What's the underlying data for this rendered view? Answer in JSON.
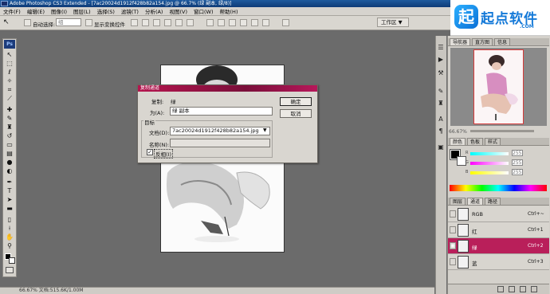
{
  "window": {
    "title": "Adobe Photoshop CS3 Extended - [7ac20024d1912f428b82a154.jpg @ 66.7% (绿 副本, 绿/8)]"
  },
  "brand": {
    "mark": "起",
    "name": "起点软件",
    "sub": ".COM"
  },
  "menu": [
    "文件(F)",
    "编辑(E)",
    "图像(I)",
    "图层(L)",
    "选择(S)",
    "滤镜(T)",
    "分析(A)",
    "视图(V)",
    "窗口(W)",
    "帮助(H)"
  ],
  "options": {
    "auto_select_label": "自动选择:",
    "auto_select_value": "组",
    "transform_label": "显示变换控件",
    "workspace_label": "工作区 ▼"
  },
  "dialog": {
    "title": "复制通道",
    "copy_label": "复制:",
    "copy_value": "绿",
    "as_label": "为(A):",
    "as_value": "绿 副本",
    "ok_label": "确定",
    "cancel_label": "取消",
    "target_group_label": "目标",
    "document_label": "文档(D):",
    "document_value": "7ac20024d1912f428b82a154.jpg",
    "name_label": "名称(N):",
    "name_value": "",
    "invert_label": "反相(I)",
    "invert_checked": true
  },
  "panels": {
    "navigator_tabs": [
      "导航器",
      "直方图",
      "信息"
    ],
    "zoom_value": "66.67%",
    "color_tabs": [
      "颜色",
      "色板",
      "样式"
    ],
    "color_values": [
      "255",
      "255",
      "255"
    ],
    "color_letters": [
      "R",
      "G",
      "B"
    ],
    "channels_tabs": [
      "图层",
      "通道",
      "路径"
    ],
    "channels": [
      {
        "name": "RGB",
        "shortcut": "Ctrl+~",
        "selected": false
      },
      {
        "name": "红",
        "shortcut": "Ctrl+1",
        "selected": false
      },
      {
        "name": "绿",
        "shortcut": "Ctrl+2",
        "selected": true
      },
      {
        "name": "蓝",
        "shortcut": "Ctrl+3",
        "selected": false
      }
    ]
  },
  "status": {
    "text": "66.67%   文档:515.6K/1.00M"
  }
}
